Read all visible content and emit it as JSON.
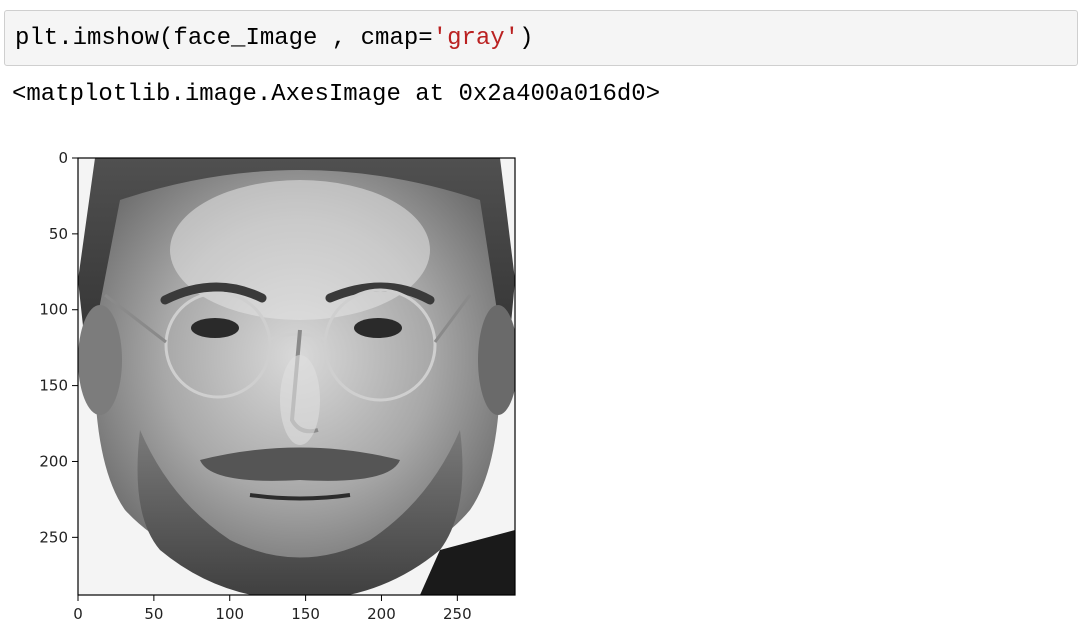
{
  "cell": {
    "code_prefix": "plt.imshow(face_Image , cmap=",
    "code_string": "'gray'",
    "code_suffix": ")"
  },
  "output": {
    "text": "<matplotlib.image.AxesImage at 0x2a400a016d0>"
  },
  "chart_data": {
    "type": "image",
    "cmap": "gray",
    "image_content": "grayscale face photograph",
    "xlim": [
      0,
      288
    ],
    "ylim": [
      288,
      0
    ],
    "x_ticks": [
      0,
      50,
      100,
      150,
      200,
      250
    ],
    "y_ticks": [
      0,
      50,
      100,
      150,
      200,
      250
    ],
    "x_tick_labels": [
      "0",
      "50",
      "100",
      "150",
      "200",
      "250"
    ],
    "y_tick_labels": [
      "0",
      "50",
      "100",
      "150",
      "200",
      "250"
    ]
  }
}
